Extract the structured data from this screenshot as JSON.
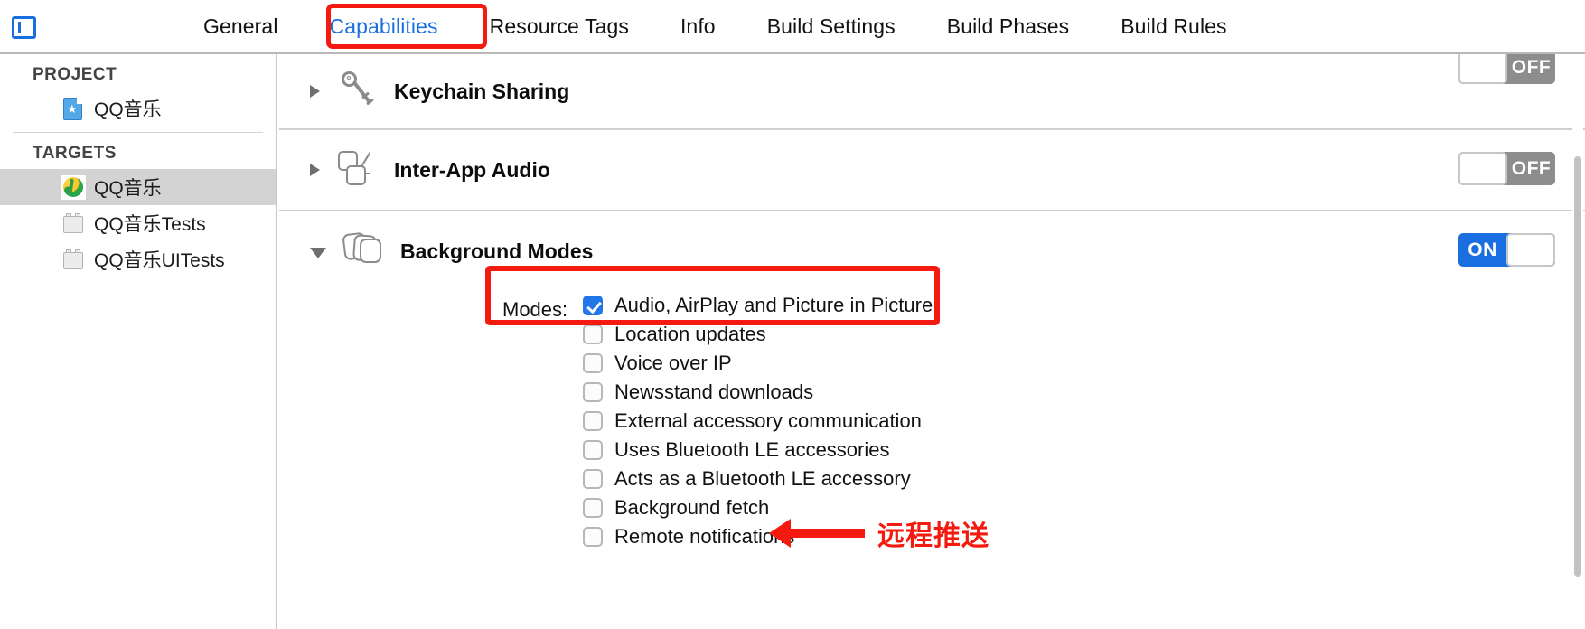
{
  "window": {
    "editor_toggle_icon": "navigator-toggle-icon"
  },
  "tabbar": {
    "tabs": [
      {
        "label": "General",
        "active": false
      },
      {
        "label": "Capabilities",
        "active": true
      },
      {
        "label": "Resource Tags",
        "active": false
      },
      {
        "label": "Info",
        "active": false
      },
      {
        "label": "Build Settings",
        "active": false
      },
      {
        "label": "Build Phases",
        "active": false
      },
      {
        "label": "Build Rules",
        "active": false
      }
    ],
    "highlight_color": "#f51a0f",
    "active_color": "#1a6fe0"
  },
  "sidebar": {
    "project_header": "PROJECT",
    "project_items": [
      {
        "label": "QQ音乐",
        "icon": "xcode-project-icon"
      }
    ],
    "targets_header": "TARGETS",
    "target_items": [
      {
        "label": "QQ音乐",
        "icon": "app-target-icon",
        "selected": true
      },
      {
        "label": "QQ音乐Tests",
        "icon": "test-bundle-icon",
        "selected": false
      },
      {
        "label": "QQ音乐UITests",
        "icon": "test-bundle-icon",
        "selected": false
      }
    ]
  },
  "capabilities": [
    {
      "title": "Keychain Sharing",
      "icon": "key-icon",
      "expanded": false,
      "switch_label": "OFF",
      "switch_on": false
    },
    {
      "title": "Inter-App Audio",
      "icon": "inter-app-audio-icon",
      "expanded": false,
      "switch_label": "OFF",
      "switch_on": false
    },
    {
      "title": "Background Modes",
      "icon": "background-modes-icon",
      "expanded": true,
      "switch_label": "ON",
      "switch_on": true
    }
  ],
  "background_modes": {
    "modes_label": "Modes:",
    "items": [
      {
        "label": "Audio, AirPlay and Picture in Picture",
        "checked": true
      },
      {
        "label": "Location updates",
        "checked": false
      },
      {
        "label": "Voice over IP",
        "checked": false
      },
      {
        "label": "Newsstand downloads",
        "checked": false
      },
      {
        "label": "External accessory communication",
        "checked": false
      },
      {
        "label": "Uses Bluetooth LE accessories",
        "checked": false
      },
      {
        "label": "Acts as a Bluetooth LE accessory",
        "checked": false
      },
      {
        "label": "Background fetch",
        "checked": false
      },
      {
        "label": "Remote notifications",
        "checked": false
      }
    ]
  },
  "annotations": {
    "modes_highlight_color": "#f51a0f",
    "arrow_color": "#f51a0f",
    "remote_notification_note": "远程推送"
  }
}
